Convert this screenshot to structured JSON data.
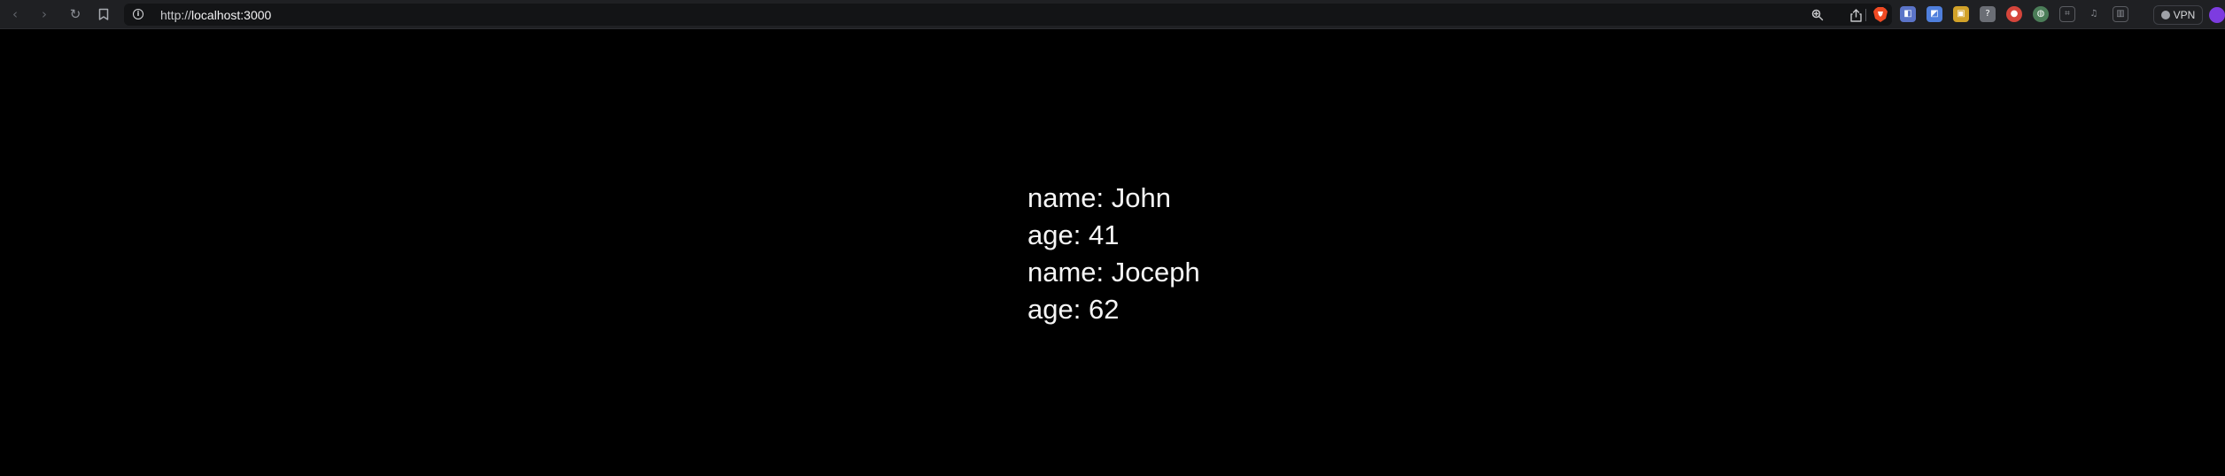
{
  "browser": {
    "url_prefix": "http://",
    "url_host": "localhost:3000",
    "vpn_label": "VPN",
    "icons": {
      "back": "chevron-left-icon",
      "forward": "chevron-right-icon",
      "reload": "reload-icon",
      "bookmark": "bookmark-icon",
      "site_info": "info-icon",
      "zoom": "zoom-icon",
      "share": "share-icon",
      "brave": "brave-lion-icon"
    },
    "extensions": [
      {
        "name": "extension-1-icon",
        "color": "#5b74c8"
      },
      {
        "name": "extension-2-icon",
        "color": "#4f7fdc"
      },
      {
        "name": "extension-3-icon",
        "color": "#d2a229"
      },
      {
        "name": "extension-4-icon",
        "color": "#6b6e75"
      },
      {
        "name": "extension-5-icon",
        "color": "#d5453b"
      },
      {
        "name": "extension-6-icon",
        "color": "#4b7d58"
      },
      {
        "name": "extension-puzzle-icon",
        "color": "#5a5c61"
      },
      {
        "name": "extension-media-icon",
        "color": "#5a5c61"
      },
      {
        "name": "extension-sidebar-icon",
        "color": "#5a5c61"
      }
    ],
    "profile_color": "#7d3ce0"
  },
  "page": {
    "people": [
      {
        "name_line": "name: John",
        "age_line": "age: 41"
      },
      {
        "name_line": "name: Joceph",
        "age_line": "age: 62"
      }
    ]
  }
}
